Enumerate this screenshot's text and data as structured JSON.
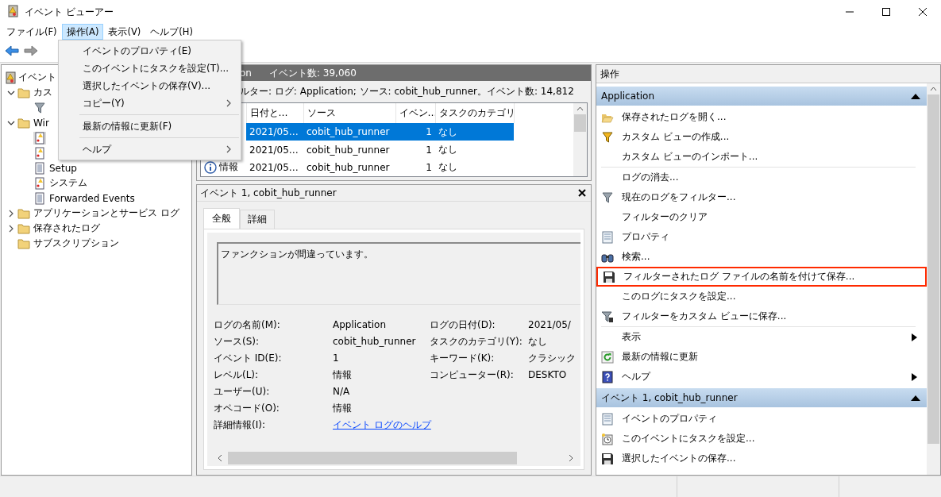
{
  "window": {
    "title": "イベント ビューアー"
  },
  "menu_bar": [
    {
      "label": "ファイル(F)",
      "selected": false
    },
    {
      "label": "操作(A)",
      "selected": true
    },
    {
      "label": "表示(V)",
      "selected": false
    },
    {
      "label": "ヘルプ(H)",
      "selected": false
    }
  ],
  "dropdown": [
    {
      "kind": "item",
      "label": "イベントのプロパティ(E)",
      "submenu": false
    },
    {
      "kind": "item",
      "label": "このイベントにタスクを設定(T)...",
      "submenu": false
    },
    {
      "kind": "item",
      "label": "選択したイベントの保存(V)...",
      "submenu": false
    },
    {
      "kind": "item",
      "label": "コピー(Y)",
      "submenu": true
    },
    {
      "kind": "separator"
    },
    {
      "kind": "item",
      "label": "最新の情報に更新(F)",
      "submenu": false
    },
    {
      "kind": "separator"
    },
    {
      "kind": "item",
      "label": "ヘルプ",
      "submenu": true
    }
  ],
  "tree": [
    {
      "label": "イベント",
      "selected": false,
      "children": [
        {
          "label": "カス",
          "selected": false,
          "expanded": true,
          "children": [
            {
              "selected": false
            }
          ]
        },
        {
          "label": "Wir",
          "selected": false,
          "expanded": true,
          "children": [
            {
              "selected": true
            },
            {
              "selected": false
            },
            {
              "label": "Setup",
              "selected": false
            },
            {
              "label": "システム",
              "selected": false
            },
            {
              "label": "Forwarded Events",
              "selected": false
            }
          ]
        },
        {
          "label": "アプリケーションとサービス ログ",
          "selected": false,
          "expanded": false
        },
        {
          "label": "保存されたログ",
          "selected": false,
          "expanded": false
        },
        {
          "label": "サブスクリプション",
          "selected": false
        }
      ]
    }
  ],
  "log_header": {
    "title": "on",
    "count": "イベント数: 39,060"
  },
  "filter_line": "ルター: ログ: Application; ソース: cobit_hub_runner。イベント数: 14,812",
  "table": {
    "columns": [
      "日付と…",
      "ソース",
      "イベン…",
      "タスクのカテゴリ"
    ],
    "rows": [
      {
        "date": "2021/05…",
        "source": "cobit_hub_runner",
        "event_id": "1",
        "category": "なし",
        "selected": true
      },
      {
        "date": "2021/05…",
        "source": "cobit_hub_runner",
        "event_id": "1",
        "category": "なし",
        "selected": false
      },
      {
        "level": "情報",
        "date": "2021/05…",
        "source": "cobit_hub_runner",
        "event_id": "1",
        "category": "なし",
        "selected": false
      }
    ]
  },
  "detail": {
    "title": "イベント 1, cobit_hub_runner",
    "tabs": [
      {
        "label": "全般",
        "selected": true
      },
      {
        "label": "詳細",
        "selected": false
      }
    ],
    "message": "ファンクションが間違っています。",
    "fields_left": [
      {
        "label": "ログの名前(M):",
        "value": "Application"
      },
      {
        "label": "ソース(S):",
        "value": "cobit_hub_runner"
      },
      {
        "label": "イベント ID(E):",
        "value": "1"
      },
      {
        "label": "レベル(L):",
        "value": "情報"
      },
      {
        "label": "ユーザー(U):",
        "value": "N/A"
      },
      {
        "label": "オペコード(O):",
        "value": "情報"
      },
      {
        "label": "詳細情報(I):",
        "link": "イベント ログのヘルプ"
      }
    ],
    "fields_right": [
      {
        "label": "ログの日付(D):",
        "value": "2021/05/"
      },
      {
        "label": "タスクのカテゴリ(Y):",
        "value": "なし"
      },
      {
        "label": "キーワード(K):",
        "value": "クラシック"
      },
      {
        "label": "コンピューター(R):",
        "value": "DESKTO"
      }
    ]
  },
  "actions": {
    "title": "操作",
    "sections": [
      {
        "title": "Application",
        "items": [
          {
            "kind": "item",
            "label": "保存されたログを開く...",
            "submenu": false,
            "highlighted": false
          },
          {
            "kind": "item",
            "label": "カスタム ビューの作成...",
            "submenu": false,
            "highlighted": false
          },
          {
            "kind": "item",
            "label": "カスタム ビューのインポート...",
            "submenu": false,
            "highlighted": false
          },
          {
            "kind": "separator"
          },
          {
            "kind": "item",
            "label": "ログの消去...",
            "submenu": false,
            "highlighted": false
          },
          {
            "kind": "item",
            "label": "現在のログをフィルター...",
            "submenu": false,
            "highlighted": false
          },
          {
            "kind": "item",
            "label": "フィルターのクリア",
            "submenu": false,
            "highlighted": false
          },
          {
            "kind": "item",
            "label": "プロパティ",
            "submenu": false,
            "highlighted": false
          },
          {
            "kind": "item",
            "label": "検索...",
            "submenu": false,
            "highlighted": false
          },
          {
            "kind": "item",
            "label": "フィルターされたログ ファイルの名前を付けて保存...",
            "submenu": false,
            "highlighted": true
          },
          {
            "kind": "item",
            "label": "このログにタスクを設定...",
            "submenu": false,
            "highlighted": false
          },
          {
            "kind": "item",
            "label": "フィルターをカスタム ビューに保存...",
            "submenu": false,
            "highlighted": false
          },
          {
            "kind": "separator"
          },
          {
            "kind": "item",
            "label": "表示",
            "submenu": true,
            "highlighted": false
          },
          {
            "kind": "item",
            "label": "最新の情報に更新",
            "submenu": false,
            "highlighted": false
          },
          {
            "kind": "item",
            "label": "ヘルプ",
            "submenu": true,
            "highlighted": false
          }
        ]
      },
      {
        "title": "イベント 1, cobit_hub_runner",
        "items": [
          {
            "kind": "item",
            "label": "イベントのプロパティ",
            "submenu": false,
            "highlighted": false
          },
          {
            "kind": "item",
            "label": "このイベントにタスクを設定...",
            "submenu": false,
            "highlighted": false
          },
          {
            "kind": "item",
            "label": "選択したイベントの保存...",
            "submenu": false,
            "highlighted": false
          }
        ]
      }
    ]
  }
}
